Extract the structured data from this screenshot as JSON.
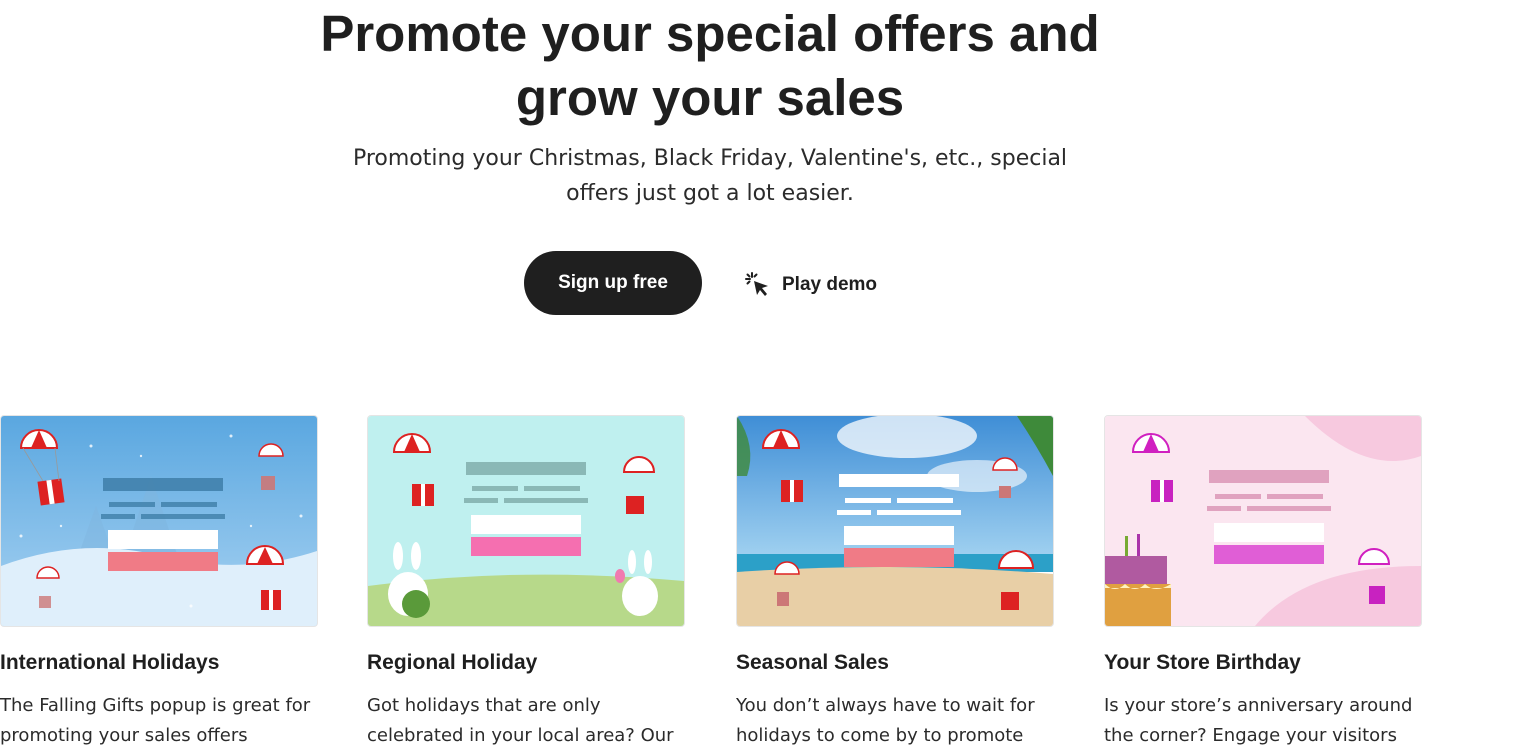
{
  "hero": {
    "title_line1": "Promote your special offers and",
    "title_line2": "grow your sales",
    "subtitle_line1": "Promoting your Christmas, Black Friday, Valentine's, etc., special",
    "subtitle_line2": "offers just got a lot easier."
  },
  "actions": {
    "signup_label": "Sign up free",
    "demo_label": "Play demo",
    "demo_icon": "pointer-click-icon"
  },
  "cards": [
    {
      "title": "International Holidays",
      "text": "The Falling Gifts popup is great for promoting your sales offers",
      "theme": "winter-snow",
      "accent": "#f07b86"
    },
    {
      "title": "Regional Holiday",
      "text": "Got holidays that are only celebrated in your local area? Our",
      "theme": "easter-bunnies",
      "accent": "#f56fb0"
    },
    {
      "title": "Seasonal Sales",
      "text": "You don’t always have to wait for holidays to come by to promote",
      "theme": "summer-beach",
      "accent": "#f07b86"
    },
    {
      "title": "Your Store Birthday",
      "text": "Is your store’s anniversary around the corner? Engage your visitors",
      "theme": "birthday-cake",
      "accent": "#e05ed6"
    }
  ]
}
